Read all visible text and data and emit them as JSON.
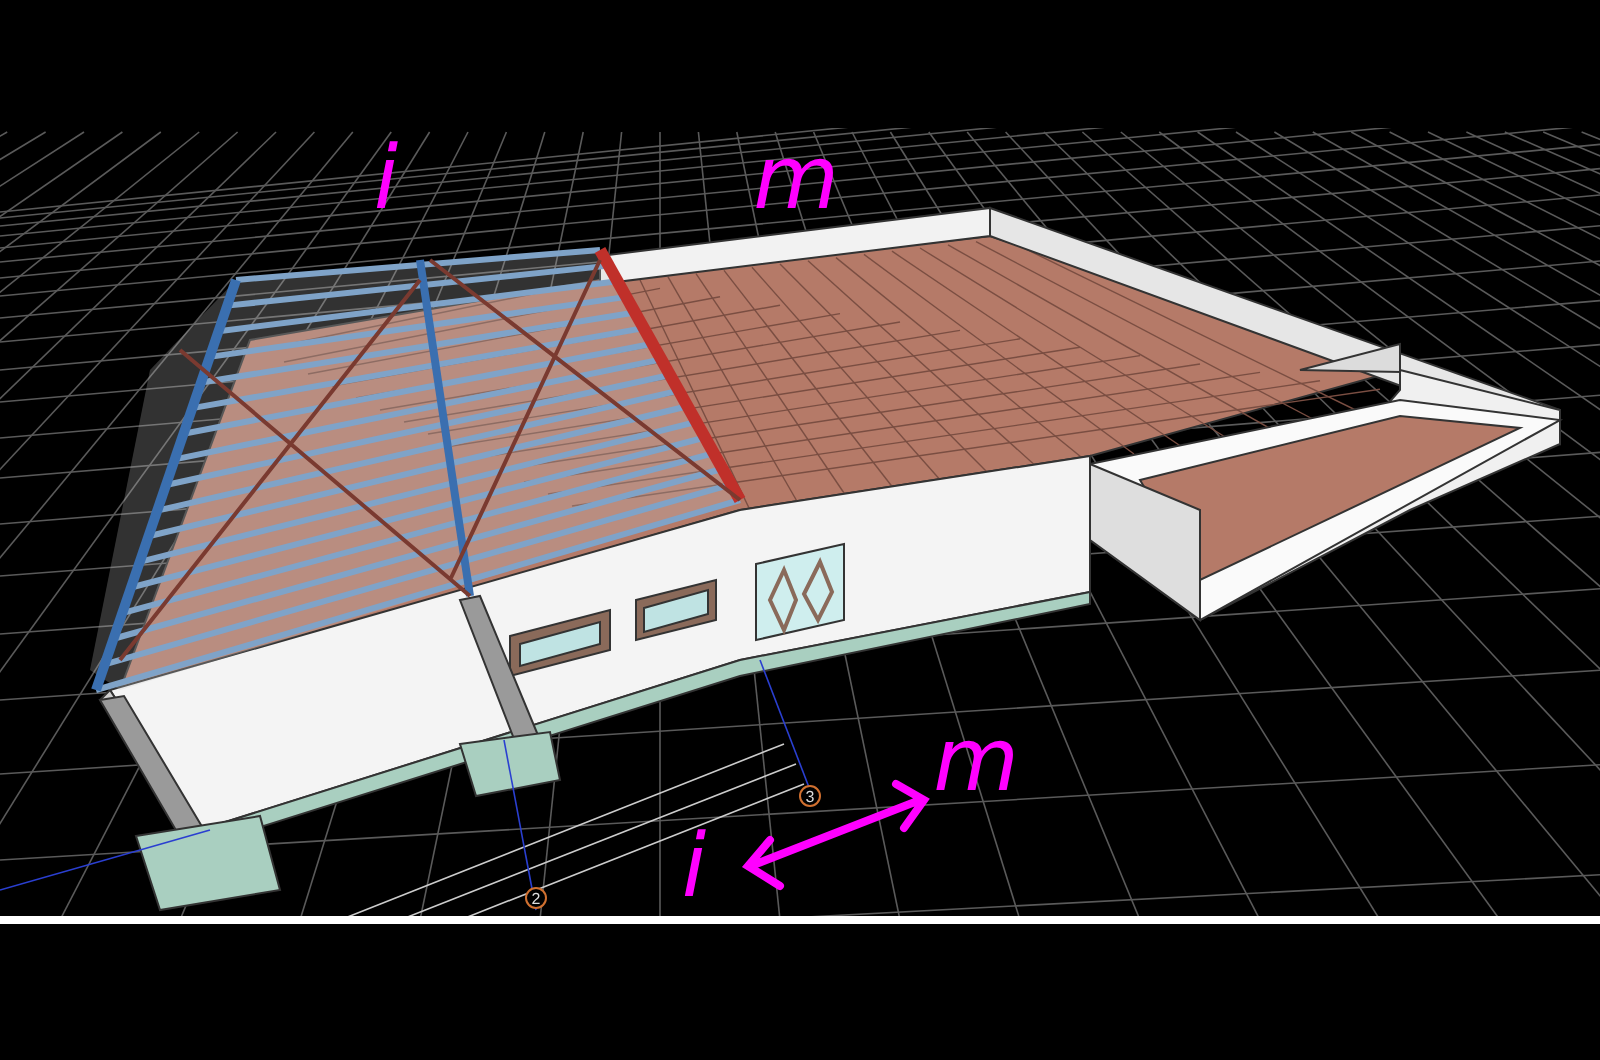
{
  "viewport": {
    "annotations": [
      {
        "text": "i"
      },
      {
        "text": "m"
      },
      {
        "text": "i"
      },
      {
        "text": "m"
      }
    ],
    "grid_markers": [
      {
        "label": "3"
      },
      {
        "label": "2"
      }
    ]
  }
}
